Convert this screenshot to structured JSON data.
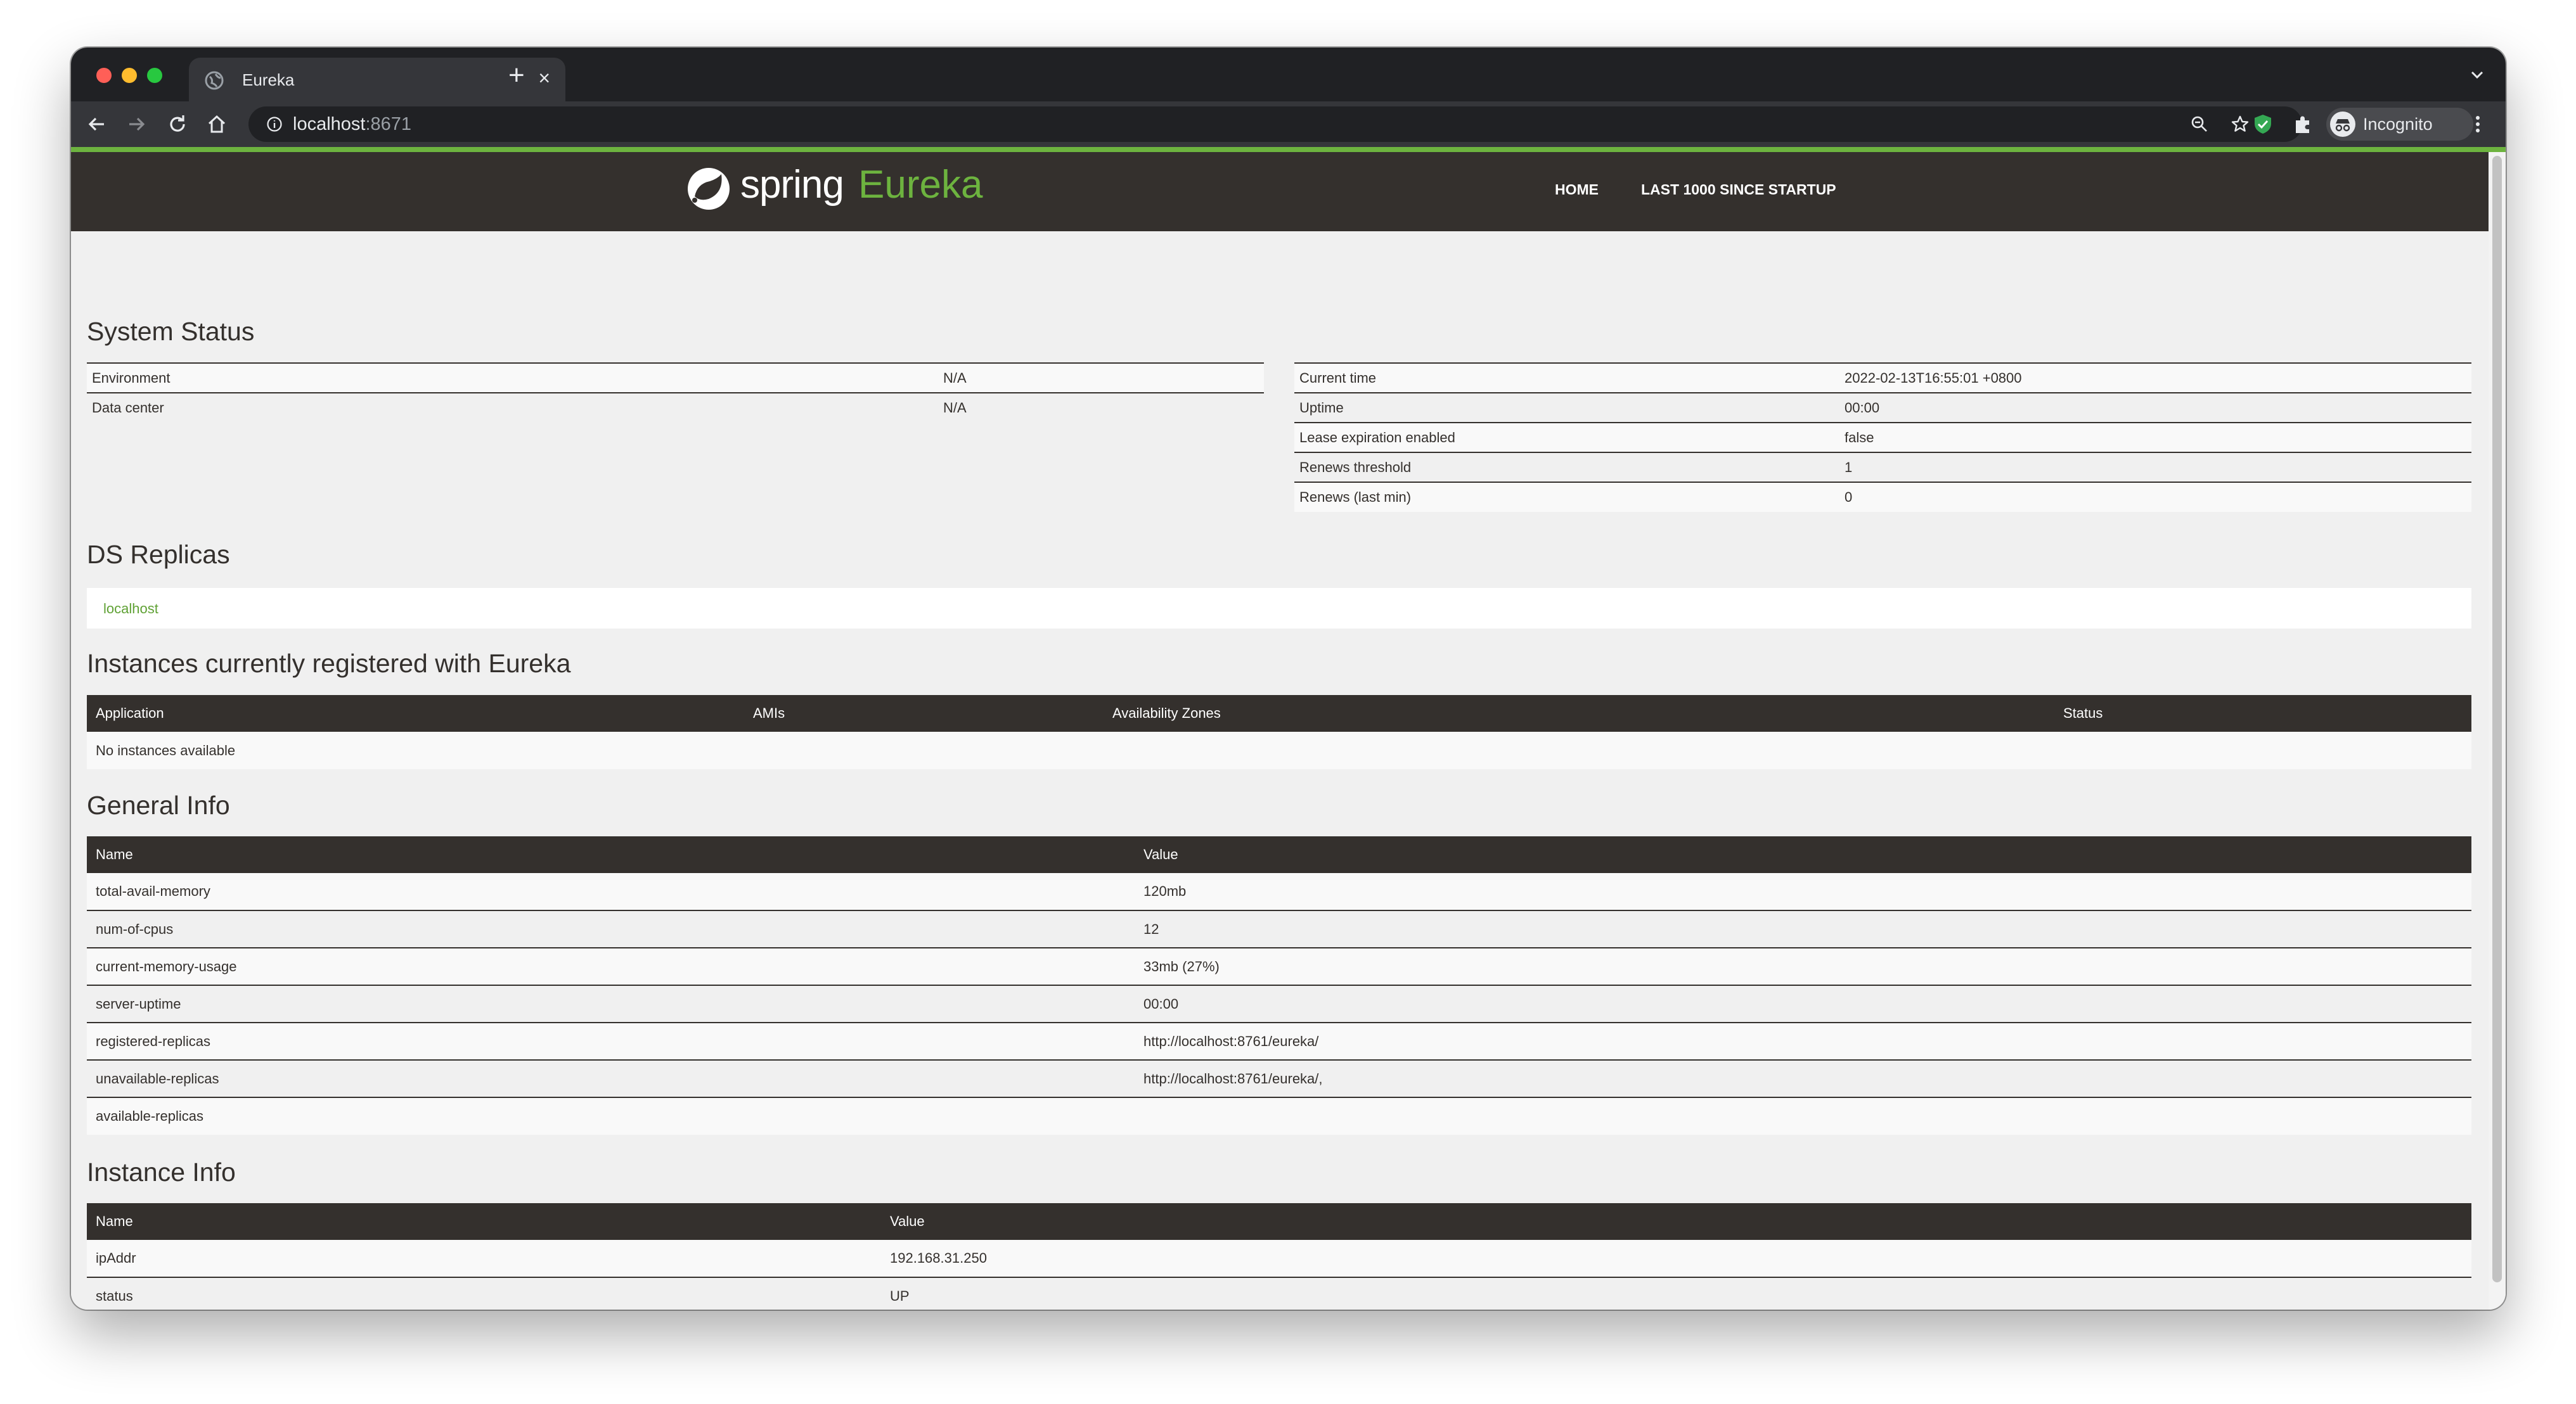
{
  "browser": {
    "tab_title": "Eureka",
    "tab_close": "×",
    "new_tab": "+",
    "url_host": "localhost",
    "url_port": ":8671",
    "profile_label": "Incognito"
  },
  "navbar": {
    "logo_spring": "spring",
    "logo_eureka": "Eureka",
    "links": [
      "HOME",
      "LAST 1000 SINCE STARTUP"
    ]
  },
  "system_status": {
    "heading": "System Status",
    "left": [
      {
        "label": "Environment",
        "value": "N/A"
      },
      {
        "label": "Data center",
        "value": "N/A"
      }
    ],
    "right": [
      {
        "label": "Current time",
        "value": "2022-02-13T16:55:01 +0800"
      },
      {
        "label": "Uptime",
        "value": "00:00"
      },
      {
        "label": "Lease expiration enabled",
        "value": "false"
      },
      {
        "label": "Renews threshold",
        "value": "1"
      },
      {
        "label": "Renews (last min)",
        "value": "0"
      }
    ]
  },
  "ds_replicas": {
    "heading": "DS Replicas",
    "items": [
      "localhost"
    ]
  },
  "instances": {
    "heading": "Instances currently registered with Eureka",
    "columns": [
      "Application",
      "AMIs",
      "Availability Zones",
      "Status"
    ],
    "empty_message": "No instances available"
  },
  "general_info": {
    "heading": "General Info",
    "columns": [
      "Name",
      "Value"
    ],
    "rows": [
      {
        "name": "total-avail-memory",
        "value": "120mb"
      },
      {
        "name": "num-of-cpus",
        "value": "12"
      },
      {
        "name": "current-memory-usage",
        "value": "33mb (27%)"
      },
      {
        "name": "server-uptime",
        "value": "00:00"
      },
      {
        "name": "registered-replicas",
        "value": "http://localhost:8761/eureka/"
      },
      {
        "name": "unavailable-replicas",
        "value": "http://localhost:8761/eureka/,"
      },
      {
        "name": "available-replicas",
        "value": ""
      }
    ]
  },
  "instance_info": {
    "heading": "Instance Info",
    "columns": [
      "Name",
      "Value"
    ],
    "rows": [
      {
        "name": "ipAddr",
        "value": "192.168.31.250"
      },
      {
        "name": "status",
        "value": "UP"
      }
    ]
  },
  "colors": {
    "spring_green": "#6db33f",
    "navbar_bg": "#34302d",
    "page_bg": "#f0f0f0"
  }
}
